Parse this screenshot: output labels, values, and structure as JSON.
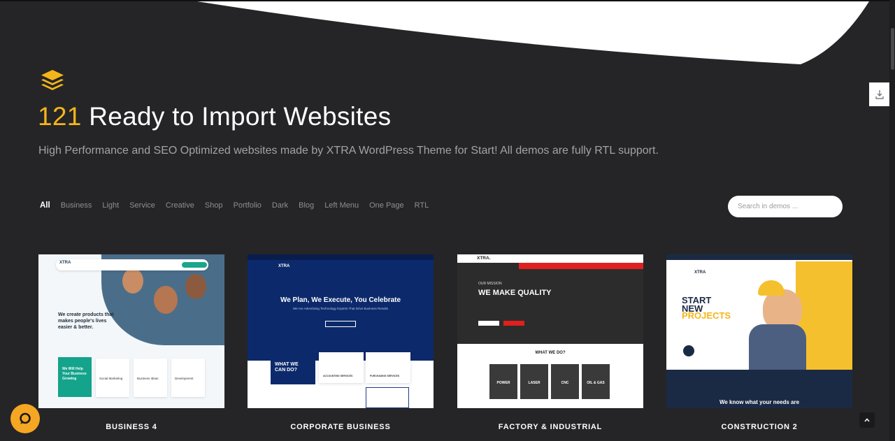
{
  "hero": {
    "count": "121",
    "title_rest": "Ready to Import Websites",
    "subtitle": "High Performance and SEO Optimized websites made by XTRA WordPress Theme for Start! All demos are fully RTL support."
  },
  "filters": [
    "All",
    "Business",
    "Light",
    "Service",
    "Creative",
    "Shop",
    "Portfolio",
    "Dark",
    "Blog",
    "Left Menu",
    "One Page",
    "RTL"
  ],
  "search": {
    "placeholder": "Search in demos ..."
  },
  "demos": [
    {
      "label": "BUSINESS 4",
      "brand": "XTRA",
      "headline": "We create products that makes people's lives easier & better.",
      "tiles": [
        "We Will Help Your Business Growing",
        "Social Marketing",
        "Business Ideas",
        "Development"
      ]
    },
    {
      "label": "CORPORATE BUSINESS",
      "brand": "XTRA",
      "headline": "We Plan, We Execute, You Celebrate",
      "sub": "We Are Advertising Technology Experts That Drive Business Results",
      "box": "WHAT WE CAN DO?",
      "services": [
        "ACCOUNTING SERVICES",
        "PURCHASING SERVICES"
      ]
    },
    {
      "label": "FACTORY & INDUSTRIAL",
      "brand": "XTRA.",
      "kicker": "OUR MISSION",
      "headline": "WE MAKE QUALITY",
      "section": "WHAT WE DO?",
      "tiles": [
        "POWER",
        "LASER",
        "CNC",
        "OIL & GAS"
      ]
    },
    {
      "label": "CONSTRUCTION 2",
      "brand": "XTRA",
      "headline_1": "START NEW",
      "headline_2": "PROJECTS",
      "bottom": "We know what your needs are"
    }
  ],
  "colors": {
    "accent": "#f5b51a",
    "background": "#252527",
    "chat": "#f5a623"
  }
}
